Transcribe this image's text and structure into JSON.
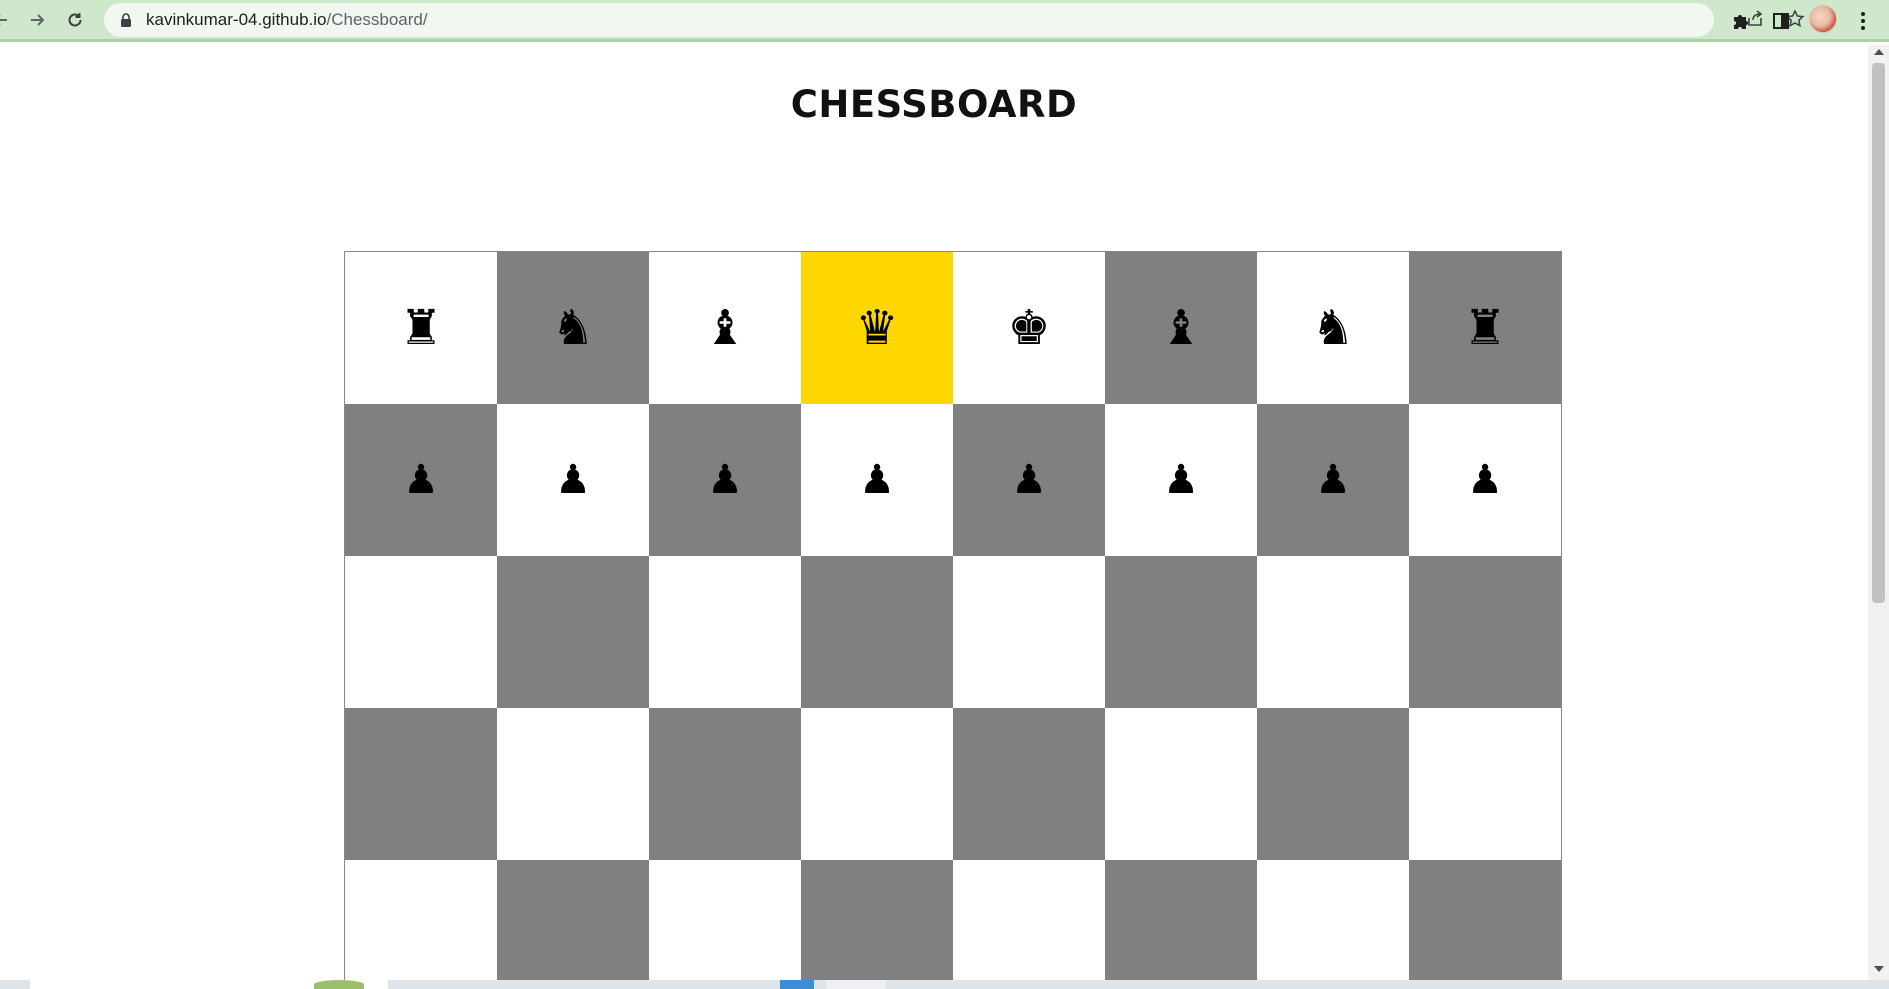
{
  "browser": {
    "url_domain": "kavinkumar-04.github.io",
    "url_path": "/Chessboard/",
    "icons": [
      "back-arrow-icon",
      "forward-arrow-icon",
      "reload-icon",
      "lock-icon",
      "share-icon",
      "star-icon",
      "puzzle-icon",
      "side-panel-icon",
      "profile-avatar",
      "kebab-menu-icon"
    ]
  },
  "page": {
    "title": "CHESSBOARD"
  },
  "colors": {
    "light_square": "#ffffff",
    "dark_square": "#808080",
    "highlight_square": "#ffd700",
    "piece": "#000000"
  },
  "board": {
    "rows": [
      [
        "♜",
        "♞",
        "♝",
        "♛",
        "♚",
        "♝",
        "♞",
        "♜"
      ],
      [
        "♟",
        "♟",
        "♟",
        "♟",
        "♟",
        "♟",
        "♟",
        "♟"
      ],
      [
        "",
        "",
        "",
        "",
        "",
        "",
        "",
        ""
      ],
      [
        "",
        "",
        "",
        "",
        "",
        "",
        "",
        ""
      ],
      [
        "",
        "",
        "",
        "",
        "",
        "",
        "",
        ""
      ]
    ],
    "highlighted": [
      [
        0,
        3
      ]
    ]
  }
}
